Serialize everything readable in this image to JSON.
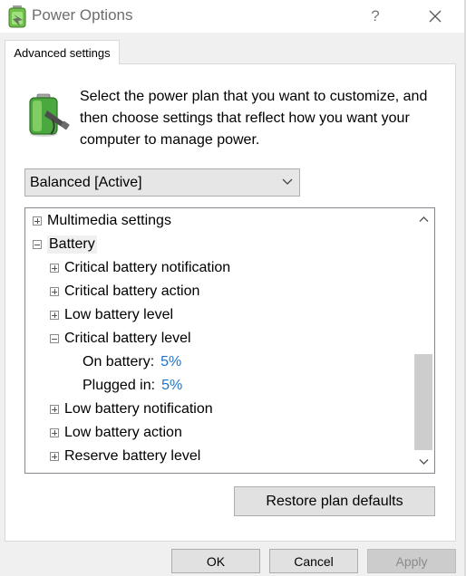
{
  "window": {
    "title": "Power Options",
    "help_label": "?",
    "close_icon": "close-icon",
    "app_icon": "power-options-icon"
  },
  "tab": {
    "label": "Advanced settings"
  },
  "description": "Select the power plan that you want to customize, and then choose settings that reflect how you want your computer to manage power.",
  "plan_select": {
    "value": "Balanced [Active]"
  },
  "tree": {
    "multimedia": "Multimedia settings",
    "battery": "Battery",
    "critical_notification": "Critical battery notification",
    "critical_action": "Critical battery action",
    "low_level": "Low battery level",
    "critical_level": "Critical battery level",
    "on_battery_label": "On battery:",
    "on_battery_value": "5%",
    "plugged_in_label": "Plugged in:",
    "plugged_in_value": "5%",
    "low_notification": "Low battery notification",
    "low_action": "Low battery action",
    "reserve_level": "Reserve battery level"
  },
  "buttons": {
    "restore": "Restore plan defaults",
    "ok": "OK",
    "cancel": "Cancel",
    "apply": "Apply"
  },
  "colors": {
    "value_blue": "#1d73c9",
    "selection_bg": "#f0f0f0",
    "battery_green": "#3ea83a"
  }
}
